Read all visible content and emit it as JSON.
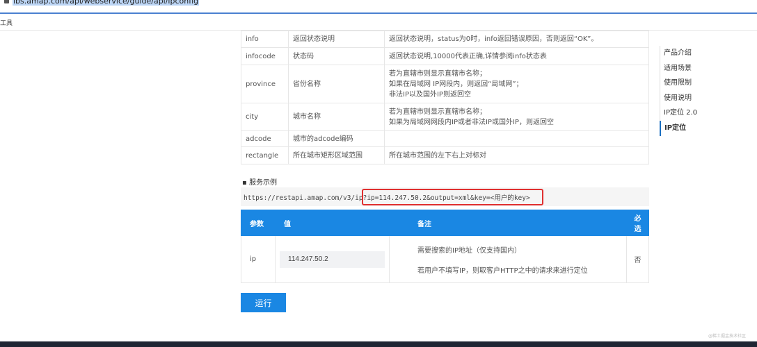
{
  "browser": {
    "url": "lbs.amap.com/api/webservice/guide/api/ipconfig",
    "toolbar_item": "工具"
  },
  "response_table": [
    {
      "name": "info",
      "meaning": "返回状态说明",
      "rule": "返回状态说明，status为0时，info返回错误原因，否则返回“OK”。"
    },
    {
      "name": "infocode",
      "meaning": "状态码",
      "rule": "返回状态说明,10000代表正确,详情参阅info状态表"
    },
    {
      "name": "province",
      "meaning": "省份名称",
      "rule": [
        "若为直辖市则显示直辖市名称；",
        "如果在局域网 IP网段内，则返回“局域网”；",
        "非法IP以及国外IP则返回空"
      ]
    },
    {
      "name": "city",
      "meaning": "城市名称",
      "rule": [
        "若为直辖市则显示直辖市名称；",
        "如果为局域网网段内IP或者非法IP或国外IP，则返回空"
      ]
    },
    {
      "name": "adcode",
      "meaning": "城市的adcode编码",
      "rule": ""
    },
    {
      "name": "rectangle",
      "meaning": "所在城市矩形区域范围",
      "rule": "所在城市范围的左下右上对标对"
    }
  ],
  "example": {
    "title": "服务示例",
    "url_prefix": "https://restapi.amap.com/v3/ip?",
    "url_params": "ip=114.247.50.2&output=xml&key=<用户的key>"
  },
  "param_table": {
    "headers": [
      "参数",
      "值",
      "备注",
      "必选"
    ],
    "row": {
      "param": "ip",
      "value": "114.247.50.2",
      "note1": "需要搜索的IP地址（仅支持国内）",
      "note2": "若用户不填写IP，则取客户HTTP之中的请求来进行定位",
      "required": "否"
    }
  },
  "run_label": "运行",
  "nav": [
    "产品介绍",
    "适用场景",
    "使用限制",
    "使用说明",
    "IP定位 2.0",
    "IP定位"
  ],
  "watermark": "@稀土掘金技术社区"
}
